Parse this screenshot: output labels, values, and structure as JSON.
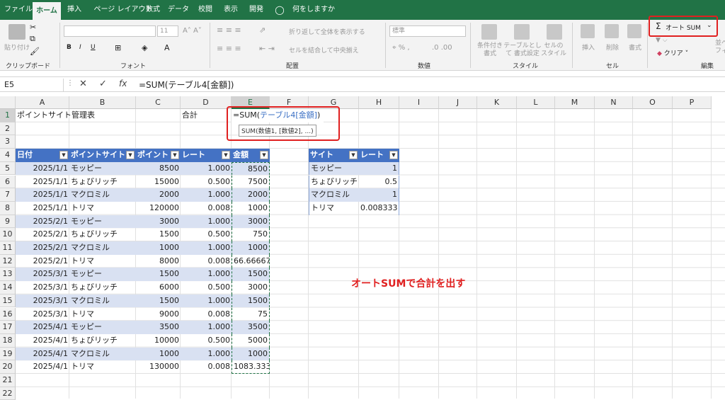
{
  "tabs": [
    "ファイル",
    "ホーム",
    "挿入",
    "ページ レイアウト",
    "数式",
    "データ",
    "校閲",
    "表示",
    "開発",
    "何をしますか"
  ],
  "ribbon": {
    "clipboard": "クリップボード",
    "font": "フォント",
    "align": "配置",
    "number": "数値",
    "styles": "スタイル",
    "cells": "セル",
    "edit": "編集",
    "paste": "貼り付け",
    "font_size": "11",
    "wrap": "折り返して全体を表示する",
    "merge": "セルを結合して中央揃え",
    "num_format": "標準",
    "cond": "条件付き 書式",
    "table": "テーブルとして 書式設定",
    "cellstyle": "セルの スタイル",
    "insert": "挿入",
    "delete": "削除",
    "format": "書式",
    "autosum": "オート SUM",
    "clear": "クリア",
    "sort": "並べ フィ"
  },
  "formula_bar": {
    "name": "E5",
    "fx": "fx",
    "formula": "=SUM(テーブル4[金額])"
  },
  "columns": [
    "A",
    "B",
    "C",
    "D",
    "E",
    "F",
    "G",
    "H",
    "I",
    "J",
    "K",
    "L",
    "M",
    "N",
    "O",
    "P"
  ],
  "rows": [
    "1",
    "2",
    "3",
    "4",
    "5",
    "6",
    "7",
    "8",
    "9",
    "10",
    "11",
    "12",
    "13",
    "14",
    "15",
    "16",
    "17",
    "18",
    "19",
    "20",
    "21",
    "22"
  ],
  "sheet": {
    "a1": "ポイントサイト管理表",
    "d1": "合計",
    "e1_prefix": "=SUM(",
    "e1_ref": "テーブル4[金額]",
    "e1_suffix": ")",
    "tooltip": "SUM(数値1, [数値2], ...)",
    "table_headers": [
      "日付",
      "ポイントサイト",
      "ポイント",
      "レート",
      "金額"
    ],
    "table_rows": [
      [
        "2025/1/1",
        "モッピー",
        "8500",
        "1.000",
        "8500"
      ],
      [
        "2025/1/1",
        "ちょびリッチ",
        "15000",
        "0.500",
        "7500"
      ],
      [
        "2025/1/1",
        "マクロミル",
        "2000",
        "1.000",
        "2000"
      ],
      [
        "2025/1/1",
        "トリマ",
        "120000",
        "0.008",
        "1000"
      ],
      [
        "2025/2/1",
        "モッピー",
        "3000",
        "1.000",
        "3000"
      ],
      [
        "2025/2/1",
        "ちょびリッチ",
        "1500",
        "0.500",
        "750"
      ],
      [
        "2025/2/1",
        "マクロミル",
        "1000",
        "1.000",
        "1000"
      ],
      [
        "2025/2/1",
        "トリマ",
        "8000",
        "0.008",
        "66.66667"
      ],
      [
        "2025/3/1",
        "モッピー",
        "1500",
        "1.000",
        "1500"
      ],
      [
        "2025/3/1",
        "ちょびリッチ",
        "6000",
        "0.500",
        "3000"
      ],
      [
        "2025/3/1",
        "マクロミル",
        "1500",
        "1.000",
        "1500"
      ],
      [
        "2025/3/1",
        "トリマ",
        "9000",
        "0.008",
        "75"
      ],
      [
        "2025/4/1",
        "モッピー",
        "3500",
        "1.000",
        "3500"
      ],
      [
        "2025/4/1",
        "ちょびリッチ",
        "10000",
        "0.500",
        "5000"
      ],
      [
        "2025/4/1",
        "マクロミル",
        "1000",
        "1.000",
        "1000"
      ],
      [
        "2025/4/1",
        "トリマ",
        "130000",
        "0.008",
        "1083.333"
      ]
    ],
    "rate_headers": [
      "サイト",
      "レート"
    ],
    "rate_rows": [
      [
        "モッピー",
        "1"
      ],
      [
        "ちょびリッチ",
        "0.5"
      ],
      [
        "マクロミル",
        "1"
      ],
      [
        "トリマ",
        "0.008333"
      ]
    ]
  },
  "annotation": "オートSUMで合計を出す",
  "colors": {
    "accent": "#217346",
    "table_header": "#4472c4",
    "band": "#d9e1f2",
    "highlight": "#e02020"
  }
}
